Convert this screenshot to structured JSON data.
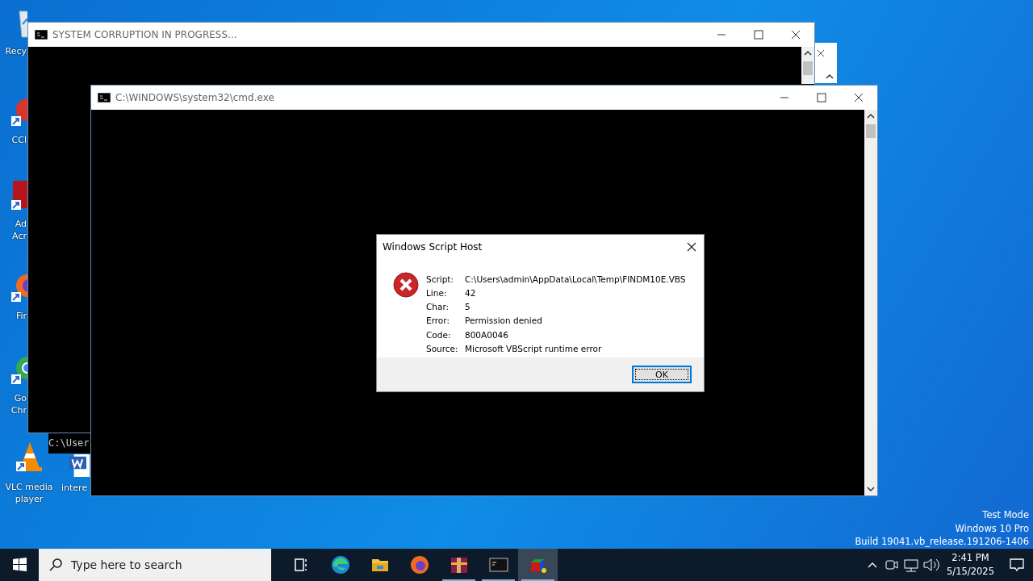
{
  "desktop_icons": [
    {
      "kind": "recycle",
      "lines": [
        "Recy"
      ]
    },
    {
      "kind": "ccleaner",
      "lines": [
        "CCl"
      ]
    },
    {
      "kind": "acrobat",
      "lines": [
        "Ad",
        "Acr"
      ]
    },
    {
      "kind": "firefox",
      "lines": [
        "Fir"
      ]
    },
    {
      "kind": "chrome",
      "lines": [
        "Go",
        "Chr"
      ]
    },
    {
      "kind": "vlc",
      "lines": [
        "VLC media",
        "player"
      ]
    },
    {
      "kind": "word",
      "lines": [
        "intere"
      ]
    }
  ],
  "back_console": {
    "text": "C:\\User"
  },
  "windows": [
    {
      "title": "SYSTEM CORRUPTION IN PROGRESS..."
    },
    {
      "title": "C:\\WINDOWS\\system32\\cmd.exe"
    }
  ],
  "dialog": {
    "title": "Windows Script Host",
    "fields": [
      {
        "label": "Script:",
        "value": "C:\\Users\\admin\\AppData\\Local\\Temp\\FINDM10E.VBS"
      },
      {
        "label": "Line:",
        "value": "42"
      },
      {
        "label": "Char:",
        "value": "5"
      },
      {
        "label": "Error:",
        "value": "Permission denied"
      },
      {
        "label": "Code:",
        "value": "800A0046"
      },
      {
        "label": "Source:",
        "value": "Microsoft VBScript runtime error"
      }
    ],
    "button": "OK"
  },
  "watermark": [
    "Test Mode",
    "Windows 10 Pro",
    "Build 19041.vb_release.191206-1406"
  ],
  "taskbar": {
    "search": {
      "placeholder": "Type here to search"
    },
    "apps": [
      {
        "kind": "taskview",
        "running": false,
        "selected": false
      },
      {
        "kind": "edge",
        "running": false,
        "selected": false
      },
      {
        "kind": "explorer",
        "running": false,
        "selected": false
      },
      {
        "kind": "firefox",
        "running": false,
        "selected": false
      },
      {
        "kind": "winrar",
        "running": true,
        "selected": false
      },
      {
        "kind": "cmd",
        "running": true,
        "selected": false
      },
      {
        "kind": "cubes",
        "running": true,
        "selected": true
      }
    ],
    "time": "2:41 PM",
    "date": "5/15/2025"
  }
}
